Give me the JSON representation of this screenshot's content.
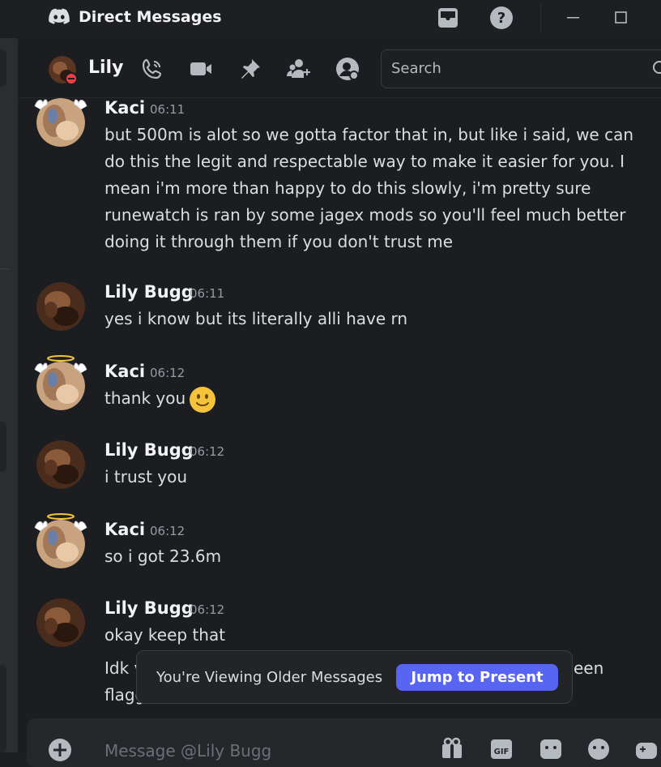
{
  "titlebar": {
    "title": "Direct Messages",
    "logo_icon": "discord-logo",
    "icons": [
      "inbox-icon",
      "help-icon",
      "minimize-icon",
      "maximize-icon"
    ]
  },
  "header": {
    "name": "Lily",
    "status": "do-not-disturb",
    "status_color": "#f23f43",
    "icons": [
      "voice-call-icon",
      "video-call-icon",
      "pinned-messages-icon",
      "add-friends-icon",
      "user-profile-icon"
    ],
    "search_placeholder": "Search"
  },
  "messages": [
    {
      "author": "Kaci",
      "time": "06:11",
      "lines": [
        "but 500m is alot so we gotta factor that in, but like i said, we can",
        "do this the legit and respectable way to make it easier for you. I",
        "mean i'm more than happy to do this slowly, i'm pretty sure",
        "runewatch is ran by some jagex mods so you'll feel much better",
        "doing it through them if you don't trust me"
      ]
    },
    {
      "author": "Lily Bugg",
      "time": "06:11",
      "lines": [
        "yes i know but its literally alli have rn"
      ]
    },
    {
      "author": "Kaci",
      "time": "06:12",
      "lines": [
        "thank you"
      ],
      "emoji": "slightly-smiling-face"
    },
    {
      "author": "Lily Bugg",
      "time": "06:12",
      "lines": [
        "i trust you"
      ]
    },
    {
      "author": "Kaci",
      "time": "06:12",
      "lines": [
        "so i got 23.6m"
      ]
    },
    {
      "author": "Lily Bugg",
      "time": "06:12",
      "lines": [
        "okay keep that"
      ]
    }
  ],
  "partial_message": {
    "left_line1": "Idk v",
    "left_line2": "flagg",
    "right_fragment": "een"
  },
  "older_banner": {
    "text": "You're Viewing Older Messages",
    "button": "Jump to Present",
    "button_color": "#5865f2"
  },
  "composer": {
    "placeholder": "Message @Lily Bugg",
    "icons": [
      "add-attachment-icon",
      "gift-icon",
      "gif-icon",
      "sticker-icon",
      "emoji-icon",
      "apps-icon"
    ]
  }
}
